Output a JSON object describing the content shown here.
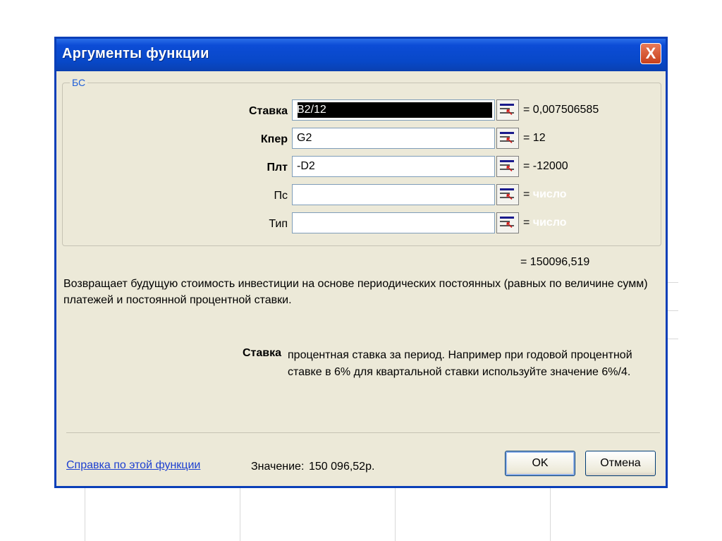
{
  "dialog": {
    "title": "Аргументы функции",
    "close_label": "X",
    "function_name": "БС"
  },
  "args": [
    {
      "label": "Ставка",
      "value": "B2/12",
      "result": "= 0,007506585",
      "bold": true,
      "selected": true
    },
    {
      "label": "Кпер",
      "value": "G2",
      "result": "= 12",
      "bold": true
    },
    {
      "label": "Плт",
      "value": "-D2",
      "result": "= -12000",
      "bold": true
    },
    {
      "label": "Пс",
      "value": "",
      "result_prefix": "=",
      "result_placeholder": "число",
      "bold": false
    },
    {
      "label": "Тип",
      "value": "",
      "result_prefix": "=",
      "result_placeholder": "число",
      "bold": false
    }
  ],
  "formula_result": "= 150096,519",
  "description": "Возвращает будущую стоимость инвестиции на основе периодических постоянных (равных по величине сумм) платежей и постоянной процентной ставки.",
  "arg_help": {
    "label": "Ставка",
    "text": "процентная ставка за период. Например при годовой процентной ставке в 6% для квартальной ставки используйте значение 6%/4."
  },
  "footer": {
    "help_link": "Справка по этой функции",
    "value_label": "Значение:",
    "value": "150 096,52р.",
    "ok_label": "OK",
    "cancel_label": "Отмена"
  },
  "colors": {
    "titlebar": "#0848c8",
    "dialog_bg": "#ece9d8",
    "link": "#1e40d0",
    "group_label": "#1e5fd8"
  }
}
